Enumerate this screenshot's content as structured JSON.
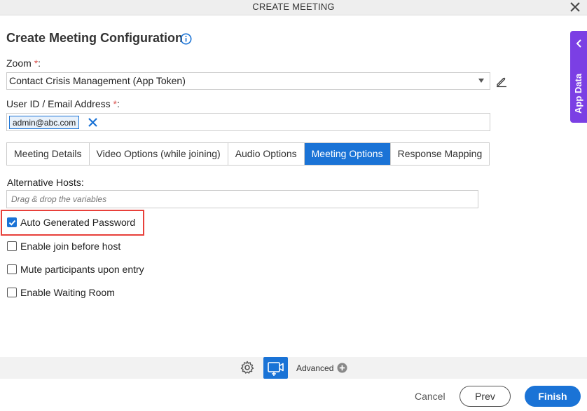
{
  "window": {
    "title": "CREATE MEETING"
  },
  "heading": "Create Meeting Configuration",
  "zoom": {
    "label": "Zoom",
    "required_mark": "*",
    "colon": ":",
    "selected": "Contact Crisis Management (App Token)"
  },
  "user": {
    "label": "User ID / Email Address",
    "required_mark": "*",
    "colon": ":",
    "tags": [
      "admin@abc.com"
    ]
  },
  "tabs": [
    {
      "label": "Meeting Details",
      "active": false
    },
    {
      "label": "Video Options (while joining)",
      "active": false
    },
    {
      "label": "Audio Options",
      "active": false
    },
    {
      "label": "Meeting Options",
      "active": true
    },
    {
      "label": "Response Mapping",
      "active": false
    }
  ],
  "alt_hosts": {
    "label": "Alternative Hosts:",
    "placeholder": "Drag & drop the variables"
  },
  "options": [
    {
      "label": "Auto Generated Password",
      "checked": true
    },
    {
      "label": "Enable join before host",
      "checked": false
    },
    {
      "label": "Mute participants upon entry",
      "checked": false
    },
    {
      "label": "Enable Waiting Room",
      "checked": false
    }
  ],
  "side_panel": {
    "label": "App Data"
  },
  "footer": {
    "advanced_label": "Advanced",
    "cancel_label": "Cancel",
    "prev_label": "Prev",
    "finish_label": "Finish"
  },
  "colors": {
    "accent": "#1a73d6",
    "side_panel": "#7b3fe4",
    "highlight": "#e8403a",
    "required": "#d9534f"
  },
  "icons": {
    "close": "close-icon",
    "info": "info-icon",
    "edit": "pencil-icon",
    "remove_tag": "close-icon",
    "checkbox": "checkmark-icon",
    "side_panel": "chevron-left-icon",
    "settings": "gear-icon",
    "video": "video-add-icon",
    "advanced": "plus-circle-icon"
  }
}
